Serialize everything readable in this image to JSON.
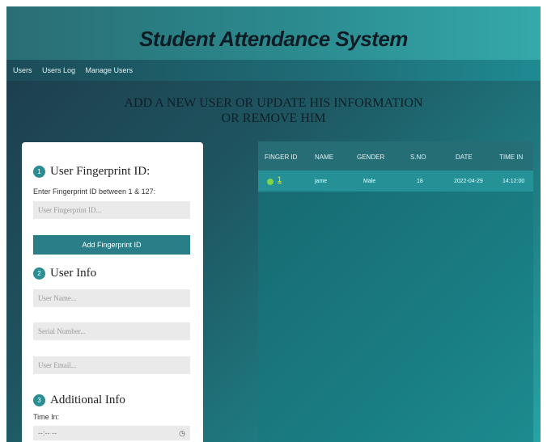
{
  "header": {
    "title": "Student Attendance System"
  },
  "nav": {
    "items": [
      "Users",
      "Users Log",
      "Manage Users"
    ]
  },
  "page": {
    "heading_line1": "ADD A NEW USER OR UPDATE HIS INFORMATION",
    "heading_line2": "OR REMOVE HIM"
  },
  "form": {
    "step1_number": "1",
    "step1_title": "User Fingerprint ID:",
    "fingerprint_label": "Enter Fingerprint ID between 1 & 127:",
    "fingerprint_placeholder": "User Fingerprint ID...",
    "add_button": "Add Fingerprint ID",
    "step2_number": "2",
    "step2_title": "User Info",
    "name_placeholder": "User Name...",
    "serial_placeholder": "Serial Number...",
    "email_placeholder": "User Email...",
    "step3_number": "3",
    "step3_title": "Additional Info",
    "time_in_label": "Time In:",
    "time_in_value": "--:-- --",
    "time_icon": "clock-icon"
  },
  "table": {
    "columns": [
      "FINGER ID",
      "NAME",
      "GENDER",
      "S.NO",
      "DATE",
      "TIME IN"
    ],
    "rows": [
      {
        "status_color": "#7bd44a",
        "finger_id": "1",
        "name": "jame",
        "gender": "Male",
        "sno": "18",
        "date": "2022-04-29",
        "time_in": "14:12:00"
      }
    ]
  },
  "colors": {
    "accent": "#2a8d94",
    "button": "#2a7e87",
    "status_dot": "#7bd44a",
    "link": "#ffea00"
  }
}
